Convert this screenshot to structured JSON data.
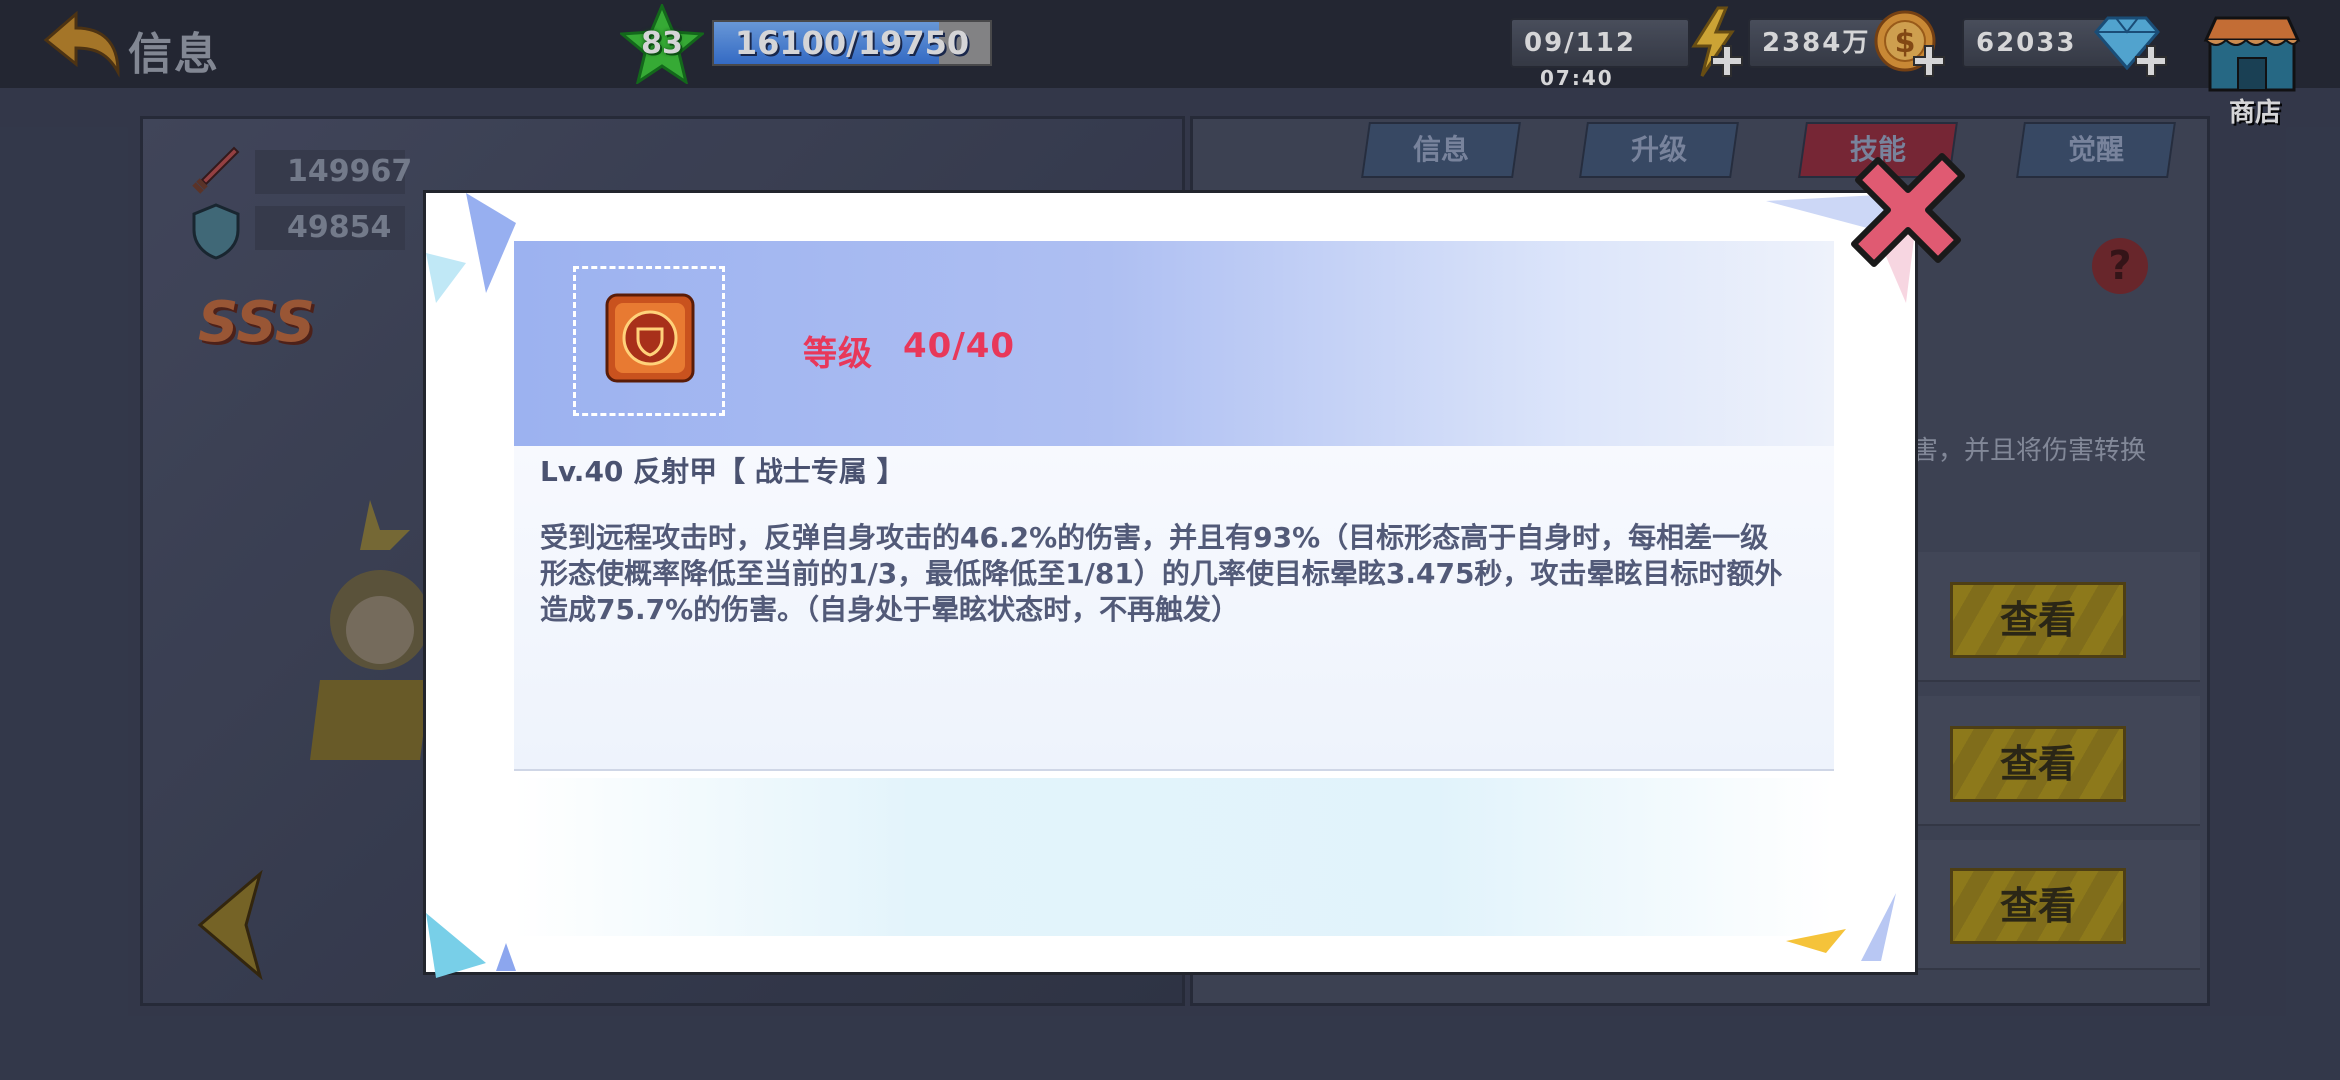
{
  "header": {
    "title": "信息",
    "player_level": "83",
    "exp": {
      "text": "16100/19750",
      "current": 16100,
      "max": 19750
    },
    "energy": {
      "value": "09/112",
      "timer": "07:40"
    },
    "gold": {
      "value": "2384万"
    },
    "gems": {
      "value": "62033"
    },
    "shop_label": "商店",
    "icons": [
      "back-arrow-icon",
      "green-star-icon",
      "lightning-icon",
      "gold-coin-icon",
      "diamond-icon",
      "shop-icon",
      "plus-icon"
    ]
  },
  "background": {
    "tabs": [
      {
        "label": "信息",
        "active": false
      },
      {
        "label": "升级",
        "active": false
      },
      {
        "label": "技能",
        "active": true
      },
      {
        "label": "觉醒",
        "active": false
      }
    ],
    "stats": {
      "attack": "149967",
      "defense": "49854"
    },
    "grade": "SSS",
    "partial_text": "害，并且将伤害转换",
    "view_buttons": [
      "查看",
      "查看",
      "查看"
    ]
  },
  "modal": {
    "level_label": "等级",
    "level_value": "40/40",
    "skill_title": "Lv.40 反射甲【 战士专属 】",
    "skill_description": "受到远程攻击时，反弹自身攻击的46.2%的伤害，并且有93%（目标形态高于自身时，每相差一级形态使概率降低至当前的1/3，最低降低至1/81）的几率使目标晕眩3.475秒，攻击晕眩目标时额外造成75.7%的伤害。（自身处于晕眩状态时，不再触发）"
  },
  "colors": {
    "accent_red": "#e8385a",
    "header_blue": "#9cb2f0",
    "body_text": "#525a78",
    "exp_fill": "#3b7de8"
  }
}
